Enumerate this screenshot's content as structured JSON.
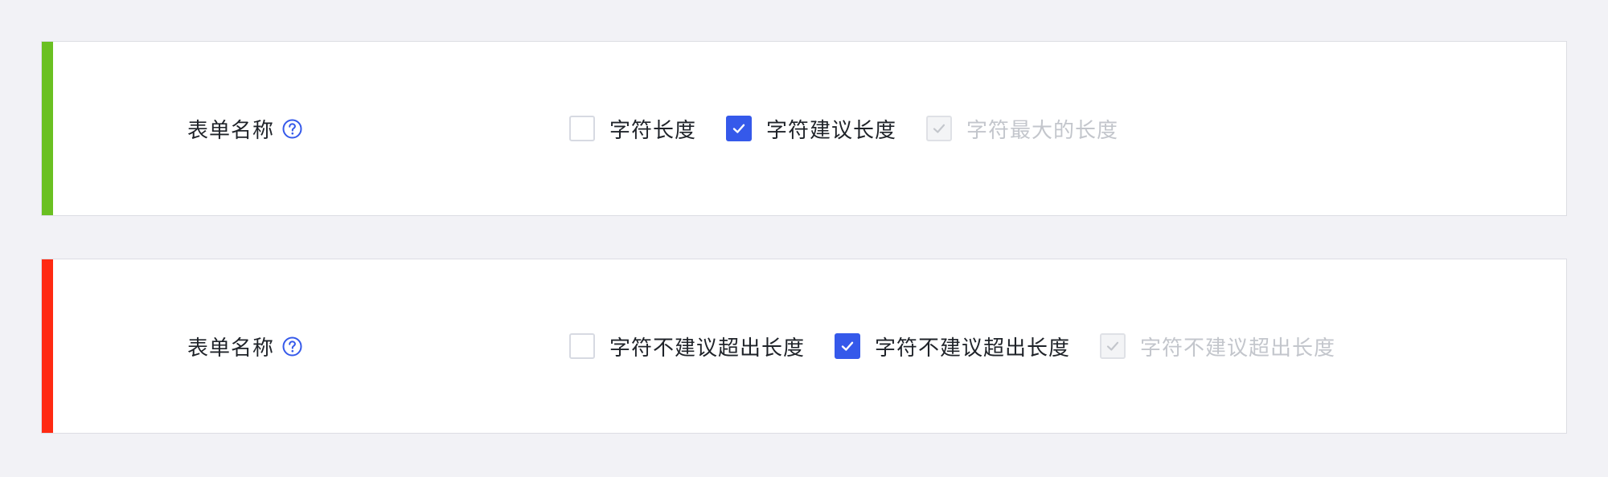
{
  "colors": {
    "page_bg": "#f2f2f6",
    "accent_success": "#6ac021",
    "accent_error": "#ff2a12",
    "primary": "#3559ea",
    "text": "#1f2329",
    "text_disabled": "#c3c6cc"
  },
  "rows": [
    {
      "accent": "green",
      "label": "表单名称",
      "help_icon": "question-circle-icon",
      "options": [
        {
          "label": "字符长度",
          "state": "unchecked"
        },
        {
          "label": "字符建议长度",
          "state": "checked"
        },
        {
          "label": "字符最大的长度",
          "state": "checked-disabled"
        }
      ]
    },
    {
      "accent": "red",
      "label": "表单名称",
      "help_icon": "question-circle-icon",
      "options": [
        {
          "label": "字符不建议超出长度",
          "state": "unchecked"
        },
        {
          "label": "字符不建议超出长度",
          "state": "checked"
        },
        {
          "label": "字符不建议超出长度",
          "state": "checked-disabled"
        }
      ]
    }
  ]
}
